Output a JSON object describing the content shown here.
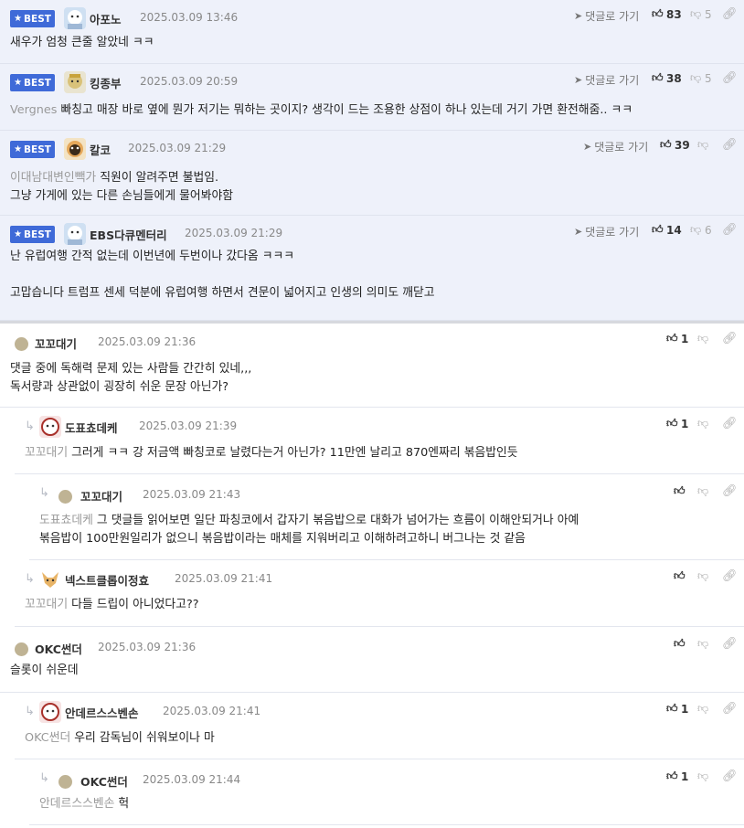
{
  "best_comments": [
    {
      "badge": "BEST",
      "nick": "아포노",
      "date": "2025.03.09 13:46",
      "goto": "댓글로 가기",
      "likes": "83",
      "dislikes": "5",
      "to": "",
      "lines": [
        "새우가 엄청 큰줄 알았네 ㅋㅋ"
      ]
    },
    {
      "badge": "BEST",
      "nick": "킹종부",
      "date": "2025.03.09 20:59",
      "goto": "댓글로 가기",
      "likes": "38",
      "dislikes": "5",
      "to": "Vergnes",
      "lines": [
        "빠칭고 매장 바로 옆에 뭔가 저기는 뭐하는 곳이지? 생각이 드는 조용한 상점이 하나 있는데 거기 가면 환전해줌.. ㅋㅋ"
      ]
    },
    {
      "badge": "BEST",
      "nick": "칼코",
      "date": "2025.03.09 21:29",
      "goto": "댓글로 가기",
      "likes": "39",
      "dislikes": "",
      "to": "이대남대변인빽가",
      "lines": [
        "직원이 알려주면 불법임.",
        "그냥 가게에 있는 다른 손님들에게 물어봐야함"
      ]
    },
    {
      "badge": "BEST",
      "nick": "EBS다큐멘터리",
      "date": "2025.03.09 21:29",
      "goto": "댓글로 가기",
      "likes": "14",
      "dislikes": "6",
      "to": "",
      "lines": [
        "난 유럽여행 간적 없는데 이번년에 두번이나 갔다옴 ㅋㅋㅋ",
        "",
        "고맙습니다 트럼프 센세 덕분에 유럽여행 하면서 견문이 넓어지고 인생의 의미도 깨닫고"
      ]
    }
  ],
  "comments": [
    {
      "nick": "꼬꼬대기",
      "date": "2025.03.09 21:36",
      "likes": "1",
      "to": "",
      "lines": [
        "댓글 중에 독해력 문제 있는 사람들 간간히 있네,,,",
        "독서량과 상관없이 굉장히 쉬운 문장 아닌가?"
      ]
    },
    {
      "nick": "도표쵸데케",
      "date": "2025.03.09 21:39",
      "likes": "1",
      "to": "꼬꼬대기",
      "lines": [
        "그러게 ㅋㅋ 강 저금액 빠칭코로 날렸다는거 아닌가? 11만엔 날리고 870엔짜리 볶음밥인듯"
      ]
    },
    {
      "nick": "꼬꼬대기",
      "date": "2025.03.09 21:43",
      "likes": "",
      "to": "도표쵸데케",
      "lines": [
        "그 댓글들 읽어보면 일단 파칭코에서 갑자기 볶음밥으로 대화가 넘어가는 흐름이 이해안되거나 아예",
        "볶음밥이 100만원일리가 없으니 볶음밥이라는 매체를 지워버리고 이해하려고하니 버그나는 것 같음"
      ]
    },
    {
      "nick": "넥스트클롭이정효",
      "date": "2025.03.09 21:41",
      "likes": "",
      "to": "꼬꼬대기",
      "lines": [
        "다들 드립이 아니었다고??"
      ]
    },
    {
      "nick": "OKC썬더",
      "date": "2025.03.09 21:36",
      "likes": "",
      "to": "",
      "lines": [
        "슬롯이 쉬운데"
      ]
    },
    {
      "nick": "안데르스스벤손",
      "date": "2025.03.09 21:41",
      "likes": "1",
      "to": "OKC썬더",
      "lines": [
        "우리 감독님이 쉬워보이나 마"
      ]
    },
    {
      "nick": "OKC썬더",
      "date": "2025.03.09 21:44",
      "likes": "1",
      "to": "안데르스스벤손",
      "lines": [
        "헉"
      ]
    }
  ],
  "colors": {
    "accent": "#3f6ad8",
    "best_bg": "#eef1fa"
  },
  "icons": {
    "like": "thumbs-up-icon",
    "dislike": "thumbs-down-icon",
    "link": "link-icon",
    "goto": "arrow-icon",
    "reply": "reply-arrow-icon"
  }
}
